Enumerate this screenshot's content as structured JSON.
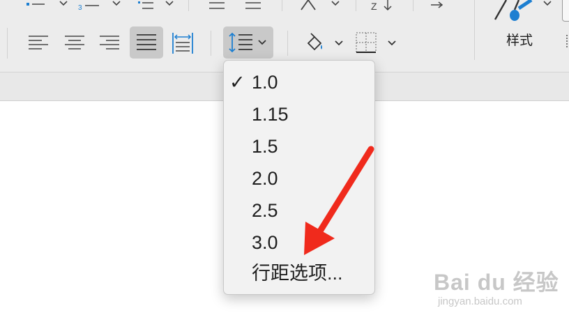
{
  "colors": {
    "ribbon_bg": "#ececec",
    "accent_blue": "#1d7fd1",
    "menu_bg": "#f2f2f2",
    "arrow_red": "#f02a1c"
  },
  "toolbar": {
    "icons": [
      "bullet-list-icon",
      "numbered-list-icon",
      "multilevel-list-icon",
      "decrease-indent-icon",
      "increase-indent-icon",
      "text-effects-icon",
      "sort-icon",
      "show-formatting-icon",
      "styles-icon"
    ],
    "paragraph_icons": [
      "align-left-icon",
      "align-center-icon",
      "align-right-icon",
      "justify-icon",
      "distributed-icon",
      "line-spacing-icon",
      "shading-icon",
      "borders-icon"
    ],
    "styles_label": "样式"
  },
  "line_spacing_menu": {
    "check_mark": "✓",
    "items": [
      {
        "label": "1.0",
        "checked": true
      },
      {
        "label": "1.15",
        "checked": false
      },
      {
        "label": "1.5",
        "checked": false
      },
      {
        "label": "2.0",
        "checked": false
      },
      {
        "label": "2.5",
        "checked": false
      },
      {
        "label": "3.0",
        "checked": false
      },
      {
        "label": "行距选项...",
        "checked": false
      }
    ]
  },
  "watermark": {
    "logo": "Bai du 经验",
    "url": "jingyan.baidu.com"
  }
}
